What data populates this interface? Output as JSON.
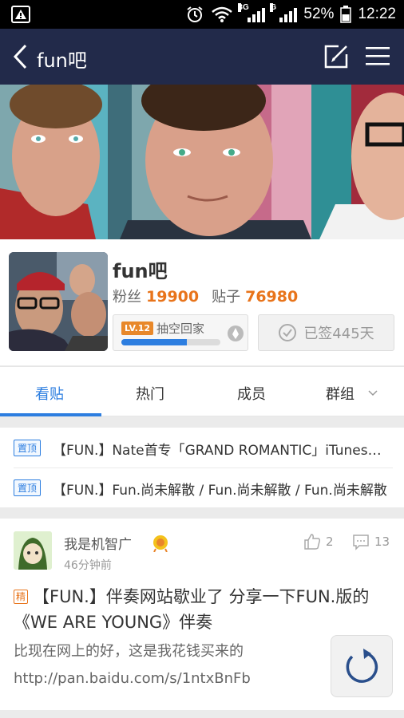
{
  "status_bar": {
    "network_3g": "3G",
    "network_g": "G",
    "battery": "52%",
    "time": "12:22"
  },
  "nav": {
    "title": "fun吧"
  },
  "forum": {
    "name": "fun吧",
    "fans_label": "粉丝",
    "fans_count": "19900",
    "posts_label": "贴子",
    "posts_count": "76980",
    "level_badge": "LV.12",
    "level_name": "抽空回家",
    "level_progress": 0.66,
    "signed_label": "已签445天"
  },
  "tabs": [
    {
      "label": "看贴",
      "active": true
    },
    {
      "label": "热门"
    },
    {
      "label": "成员"
    },
    {
      "label": "群组"
    }
  ],
  "pinned": [
    {
      "badge": "置顶",
      "title": "【FUN.】Nate首专「GRAND ROMANTIC」iTunes…"
    },
    {
      "badge": "置顶",
      "title": "【FUN.】Fun.尚未解散 / Fun.尚未解散 / Fun.尚未解散"
    }
  ],
  "post": {
    "username": "我是机智广",
    "time": "46分钟前",
    "likes": "2",
    "comments": "13",
    "tag": "精",
    "title": "【FUN.】伴奏网站歇业了 分享一下FUN.版的《WE ARE YOUNG》伴奏",
    "body": "比现在网上的好，这是我花钱买来的 http://pan.baidu.com/s/1ntxBnFb"
  },
  "colors": {
    "nav_bg": "#222a4a",
    "accent_blue": "#2d7ee0",
    "accent_orange": "#e8741b"
  }
}
